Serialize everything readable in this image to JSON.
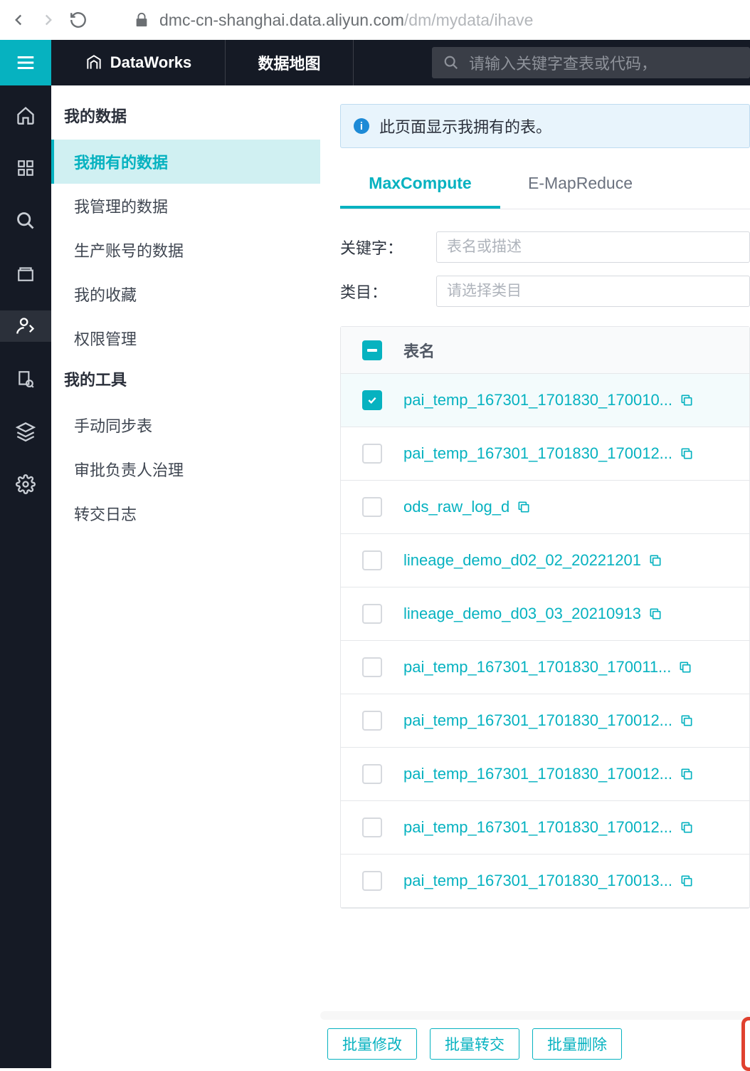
{
  "browser": {
    "host": "dmc-cn-shanghai.data.aliyun.com",
    "path": "/dm/mydata/ihave"
  },
  "header": {
    "brand": "DataWorks",
    "nav": "数据地图",
    "search_placeholder": "请输入关键字查表或代码，"
  },
  "side_menu": {
    "section1_title": "我的数据",
    "items1": [
      "我拥有的数据",
      "我管理的数据",
      "生产账号的数据",
      "我的收藏",
      "权限管理"
    ],
    "section2_title": "我的工具",
    "items2": [
      "手动同步表",
      "审批负责人治理",
      "转交日志"
    ],
    "active_index": 0
  },
  "content": {
    "banner": "此页面显示我拥有的表。",
    "tabs": [
      "MaxCompute",
      "E-MapReduce"
    ],
    "active_tab": 0,
    "filters": {
      "keyword_label": "关键字：",
      "keyword_placeholder": "表名或描述",
      "category_label": "类目：",
      "category_placeholder": "请选择类目"
    },
    "table": {
      "col_name": "表名",
      "rows": [
        {
          "name": "pai_temp_167301_1701830_170010...",
          "checked": true,
          "has_copy": true
        },
        {
          "name": "pai_temp_167301_1701830_170012...",
          "checked": false,
          "has_copy": true
        },
        {
          "name": "ods_raw_log_d",
          "checked": false,
          "has_copy": true
        },
        {
          "name": "lineage_demo_d02_02_20221201",
          "checked": false,
          "has_copy": true
        },
        {
          "name": "lineage_demo_d03_03_20210913",
          "checked": false,
          "has_copy": true
        },
        {
          "name": "pai_temp_167301_1701830_170011...",
          "checked": false,
          "has_copy": true
        },
        {
          "name": "pai_temp_167301_1701830_170012...",
          "checked": false,
          "has_copy": true
        },
        {
          "name": "pai_temp_167301_1701830_170012...",
          "checked": false,
          "has_copy": true
        },
        {
          "name": "pai_temp_167301_1701830_170012...",
          "checked": false,
          "has_copy": true
        },
        {
          "name": "pai_temp_167301_1701830_170013...",
          "checked": false,
          "has_copy": true
        }
      ]
    },
    "batch_buttons": [
      "批量修改",
      "批量转交",
      "批量删除"
    ]
  }
}
